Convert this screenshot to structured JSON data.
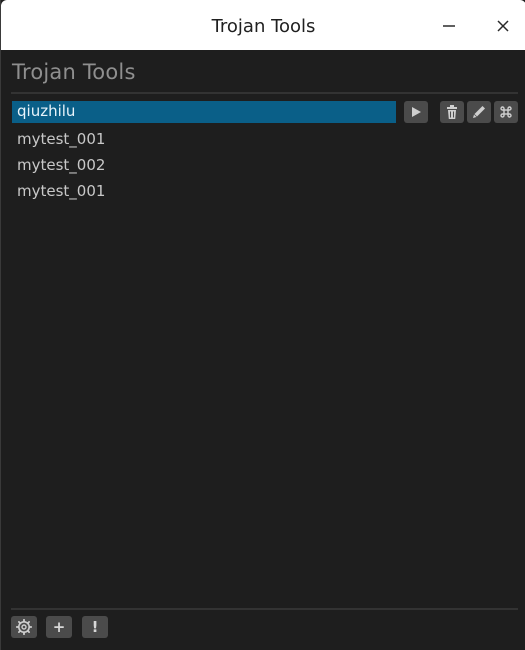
{
  "window": {
    "title": "Trojan Tools"
  },
  "app": {
    "heading": "Trojan Tools"
  },
  "profiles": {
    "items": [
      {
        "label": "qiuzhilu",
        "selected": true
      },
      {
        "label": "mytest_001",
        "selected": false
      },
      {
        "label": "mytest_002",
        "selected": false
      },
      {
        "label": "mytest_001",
        "selected": false
      }
    ]
  },
  "toolbar": {
    "icons": [
      "play-icon",
      "trash-icon",
      "pencil-icon",
      "command-icon"
    ]
  },
  "footer": {
    "icons": [
      "gear-icon",
      "plus-icon",
      "exclamation-icon"
    ],
    "add_label": "+",
    "about_label": "!"
  },
  "colors": {
    "selection": "#0a5f88",
    "background": "#1e1e1e",
    "button": "#4b4b4b"
  }
}
